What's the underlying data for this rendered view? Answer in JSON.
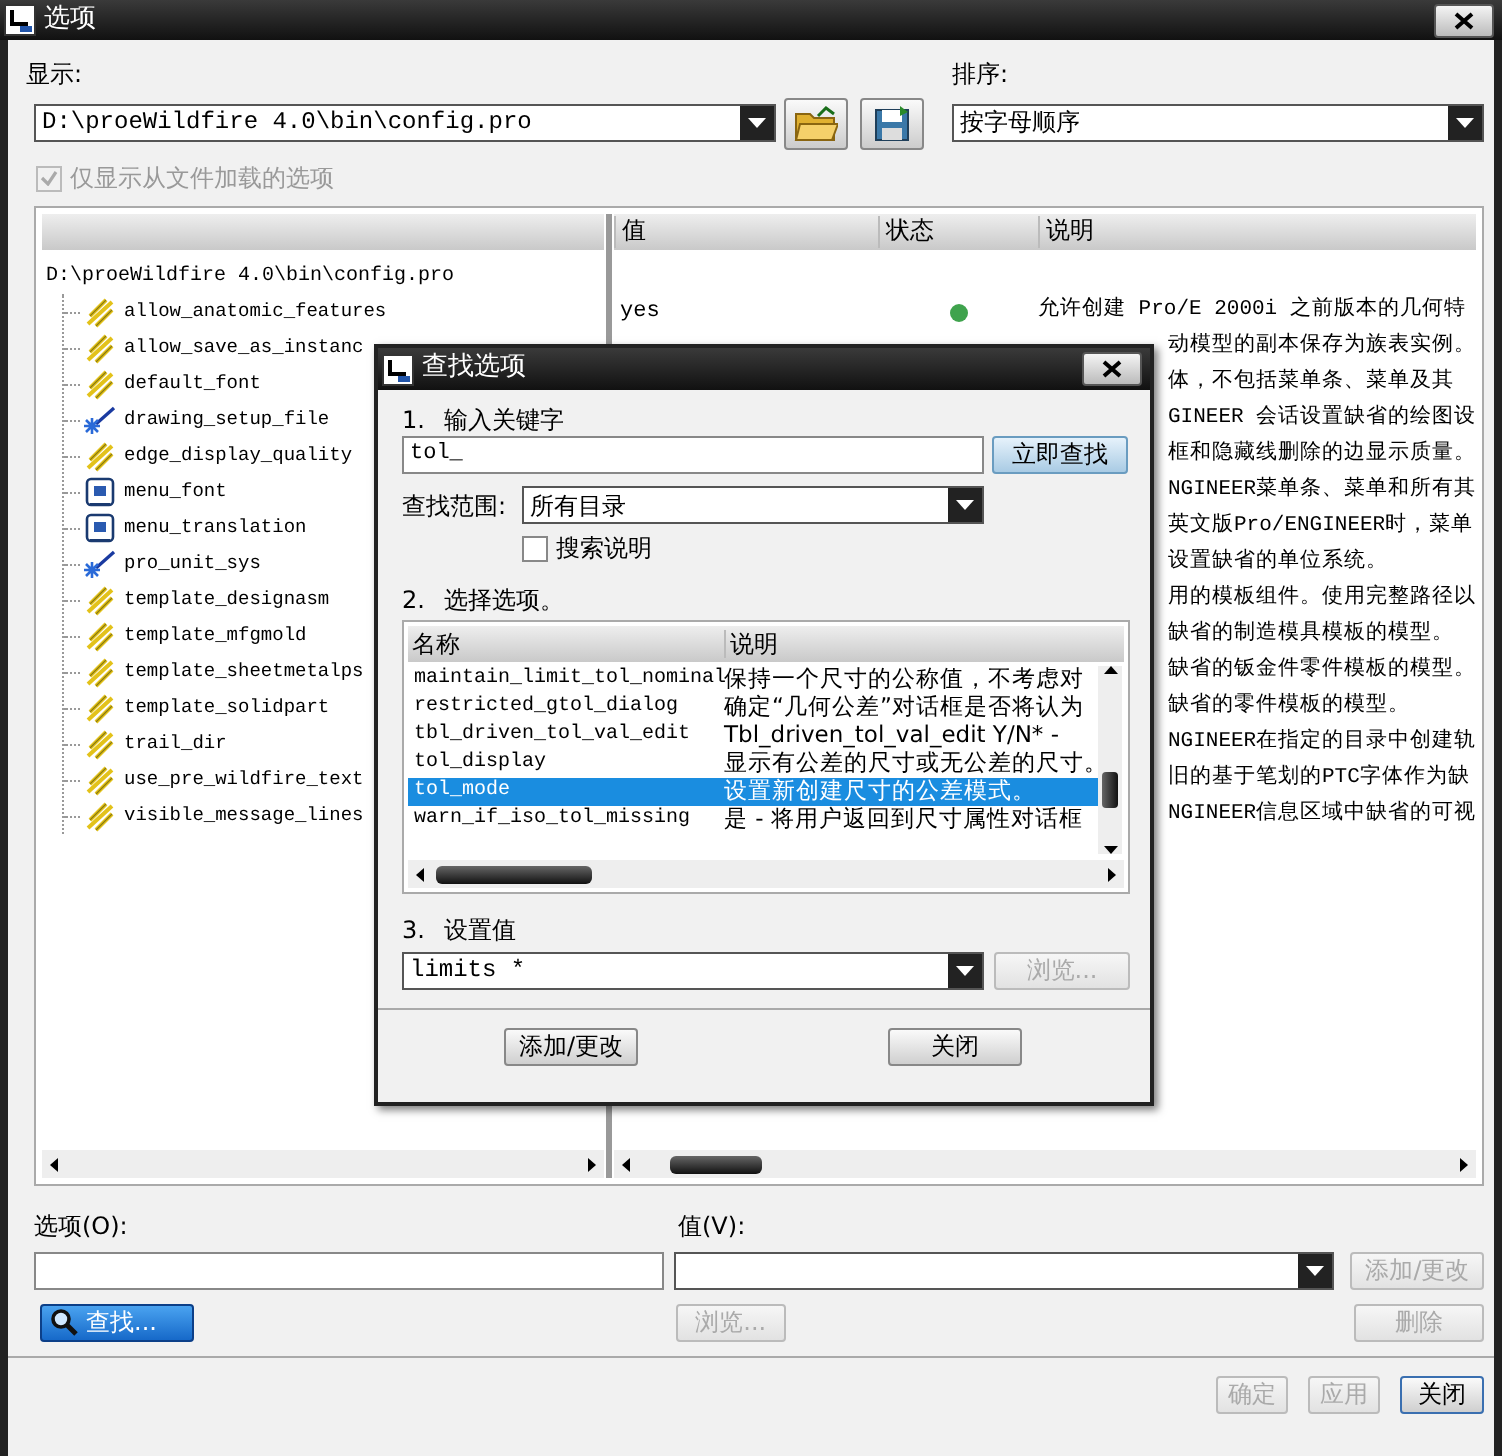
{
  "window": {
    "title": "选项"
  },
  "display": {
    "label": "显示:",
    "value": "D:\\proeWildfire 4.0\\bin\\config.pro"
  },
  "sort": {
    "label": "排序:",
    "value": "按字母顺序"
  },
  "loaded_only": {
    "label": "仅显示从文件加载的选项",
    "checked": true,
    "disabled": true
  },
  "table": {
    "columns": [
      "值",
      "状态",
      "说明"
    ],
    "root": "D:\\proeWildfire 4.0\\bin\\config.pro",
    "rows": [
      {
        "name": "allow_anatomic_features",
        "kind": "lightning",
        "value": "yes",
        "color": "#3fa34d",
        "description": "允许创建 Pro/E 2000i 之前版本的几何特"
      },
      {
        "name": "allow_save_as_instanc",
        "kind": "lightning",
        "description": "动模型的副本保存为族表实例。"
      },
      {
        "name": "default_font",
        "kind": "lightning",
        "description": "体，不包括菜单条、菜单及其"
      },
      {
        "name": "drawing_setup_file",
        "kind": "wand",
        "description": "GINEER 会话设置缺省的绘图设"
      },
      {
        "name": "edge_display_quality",
        "kind": "lightning",
        "description": "框和隐藏线删除的边显示质量。"
      },
      {
        "name": "menu_font",
        "kind": "box",
        "description": "NGINEER菜单条、菜单和所有其"
      },
      {
        "name": "menu_translation",
        "kind": "box",
        "description": "英文版Pro/ENGINEER时，菜单"
      },
      {
        "name": "pro_unit_sys",
        "kind": "wand",
        "description": "设置缺省的单位系统。"
      },
      {
        "name": "template_designasm",
        "kind": "lightning",
        "description": "用的模板组件。使用完整路径以"
      },
      {
        "name": "template_mfgmold",
        "kind": "lightning",
        "description": "缺省的制造模具模板的模型。"
      },
      {
        "name": "template_sheetmetalps",
        "kind": "lightning",
        "description": "缺省的钣金件零件模板的模型。"
      },
      {
        "name": "template_solidpart",
        "kind": "lightning",
        "description": "缺省的零件模板的模型。"
      },
      {
        "name": "trail_dir",
        "kind": "lightning",
        "description": "NGINEER在指定的目录中创建轨"
      },
      {
        "name": "use_pre_wildfire_text",
        "kind": "lightning",
        "description": "旧的基于笔划的PTC字体作为缺"
      },
      {
        "name": "visible_message_lines",
        "kind": "lightning",
        "description": "NGINEER信息区域中缺省的可视"
      }
    ]
  },
  "option_field": {
    "label": "选项(O):"
  },
  "value_field": {
    "label": "值(V):"
  },
  "add_button": {
    "label": "添加/更改",
    "disabled": true
  },
  "find_button": {
    "label": "查找..."
  },
  "browse_button": {
    "label": "浏览...",
    "disabled": true
  },
  "delete_button": {
    "label": "删除",
    "disabled": true
  },
  "footer_buttons": [
    {
      "label": "确定",
      "disabled": true
    },
    {
      "label": "应用",
      "disabled": true
    },
    {
      "label": "关闭",
      "disabled": false
    }
  ],
  "dialog": {
    "title": "查找选项",
    "step1": {
      "number": "1.",
      "label": "输入关键字"
    },
    "keyword": "tol_",
    "search_button": "立即查找",
    "scope": {
      "label": "查找范围:",
      "value": "所有目录"
    },
    "search_description": {
      "label": "搜索说明",
      "checked": false
    },
    "step2": {
      "number": "2.",
      "label": "选择选项。"
    },
    "list": {
      "columns": [
        "名称",
        "说明"
      ],
      "rows": [
        {
          "name": "maintain_limit_tol_nominal",
          "description": "保持一个尺寸的公称值，不考虑对",
          "selected": false
        },
        {
          "name": "restricted_gtol_dialog",
          "description": "确定“几何公差”对话框是否将认为",
          "selected": false
        },
        {
          "name": "tbl_driven_tol_val_edit",
          "description": "Tbl_driven_tol_val_edit Y/N* -",
          "selected": false
        },
        {
          "name": "tol_display",
          "description": "显示有公差的尺寸或无公差的尺寸。",
          "selected": false
        },
        {
          "name": "tol_mode",
          "description": "设置新创建尺寸的公差模式。",
          "selected": true
        },
        {
          "name": "warn_if_iso_tol_missing",
          "description": "是 - 将用户返回到尺寸属性对话框",
          "selected": false
        }
      ]
    },
    "step3": {
      "number": "3.",
      "label": "设置值"
    },
    "value": "limits *",
    "browse_button": {
      "label": "浏览...",
      "disabled": true
    },
    "buttons": [
      {
        "label": "添加/更改"
      },
      {
        "label": "关闭"
      }
    ]
  }
}
